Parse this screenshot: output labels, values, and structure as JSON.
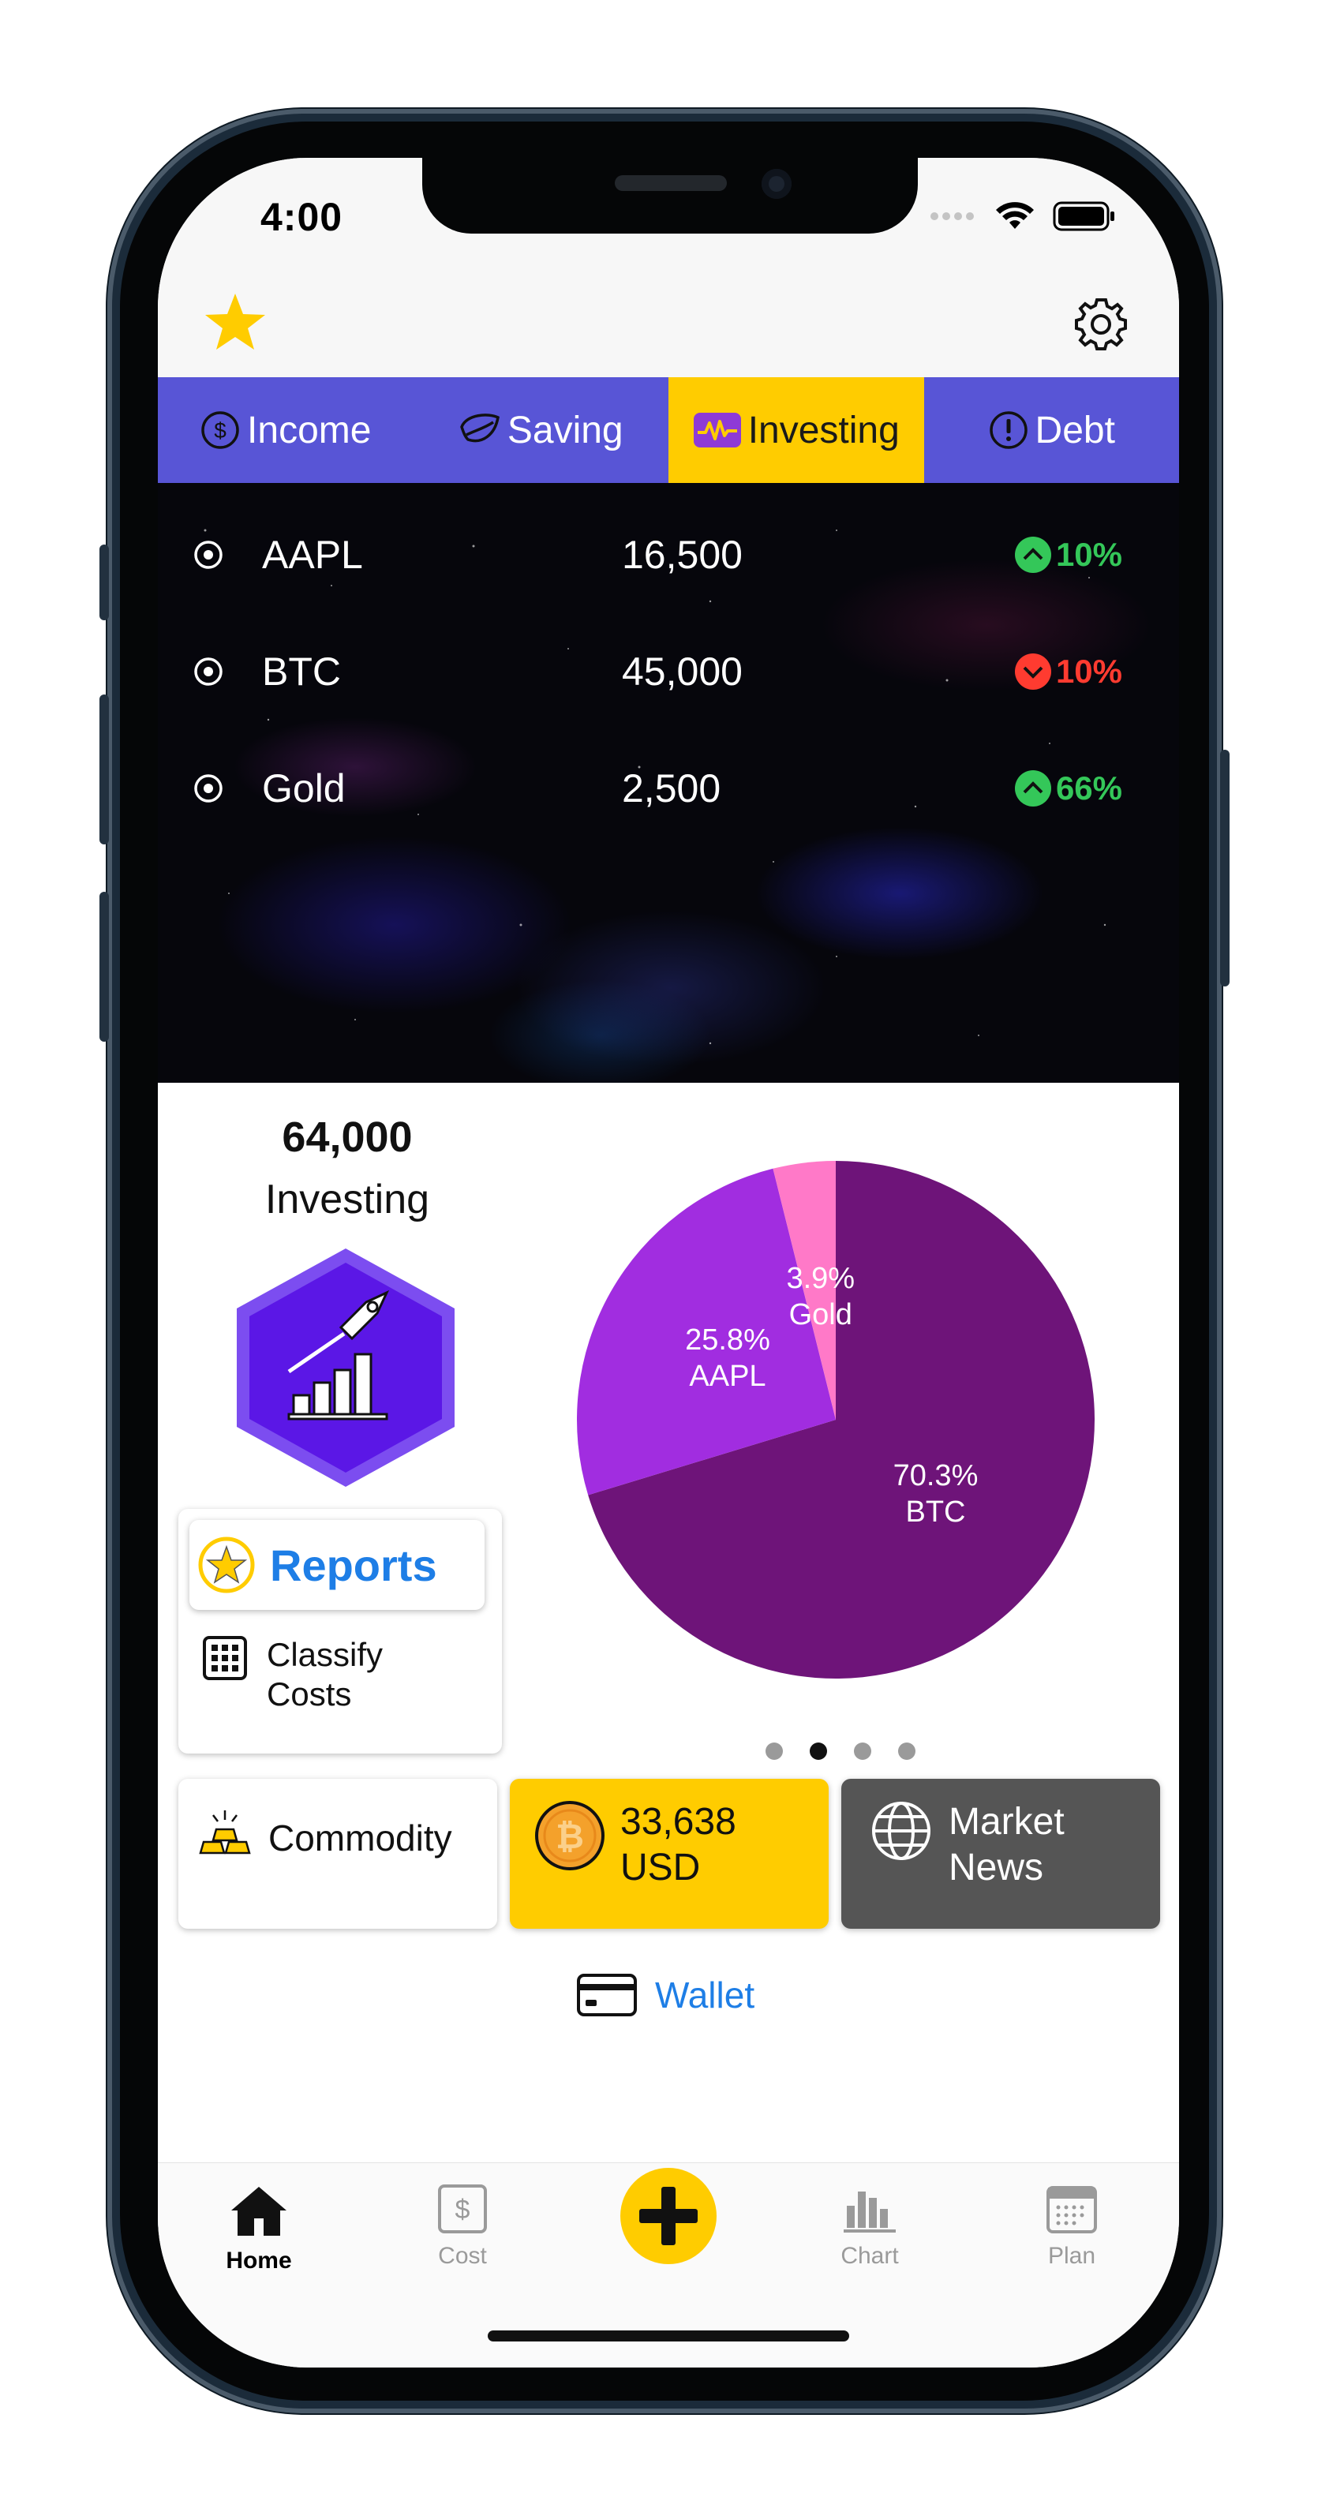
{
  "status_bar": {
    "time": "4:00"
  },
  "tabs": [
    {
      "label": "Income",
      "icon": "dollar-circle-icon"
    },
    {
      "label": "Saving",
      "icon": "leaf-icon"
    },
    {
      "label": "Investing",
      "icon": "pulse-icon",
      "active": true
    },
    {
      "label": "Debt",
      "icon": "exclamation-circle-icon"
    }
  ],
  "assets": [
    {
      "name": "AAPL",
      "value": "16,500",
      "change": "10%",
      "direction": "up"
    },
    {
      "name": "BTC",
      "value": "45,000",
      "change": "10%",
      "direction": "down"
    },
    {
      "name": "Gold",
      "value": "2,500",
      "change": "66%",
      "direction": "up"
    }
  ],
  "summary": {
    "total": "64,000",
    "label": "Investing"
  },
  "reports": {
    "label": "Reports"
  },
  "classify": {
    "line1": "Classify",
    "line2": "Costs"
  },
  "commodity": {
    "label": "Commodity"
  },
  "btc_balance": {
    "amount": "33,638",
    "currency": "USD"
  },
  "market_news": {
    "line1": "Market",
    "line2": "News"
  },
  "wallet": {
    "label": "Wallet"
  },
  "carousel": {
    "pages": 4,
    "active": 2
  },
  "tabbar": [
    {
      "label": "Home",
      "icon": "home-icon",
      "active": true
    },
    {
      "label": "Cost",
      "icon": "dollar-square-icon"
    },
    {
      "label": "",
      "icon": "plus-icon"
    },
    {
      "label": "Chart",
      "icon": "bar-chart-icon"
    },
    {
      "label": "Plan",
      "icon": "calendar-icon"
    }
  ],
  "colors": {
    "tab_bg": "#5855d6",
    "tab_active": "#ffcc00",
    "up": "#34c759",
    "down": "#ff3b30",
    "link": "#1e7ee6",
    "news_bg": "#555555",
    "hexagon": "#5b17e6"
  },
  "chart_data": {
    "type": "pie",
    "slices": [
      {
        "label": "BTC",
        "percent": 70.3,
        "percent_label": "70.3%",
        "color": "#6e1479"
      },
      {
        "label": "AAPL",
        "percent": 25.8,
        "percent_label": "25.8%",
        "color": "#a12de0"
      },
      {
        "label": "Gold",
        "percent": 3.9,
        "percent_label": "3.9%",
        "color": "#ff79c8"
      }
    ]
  }
}
